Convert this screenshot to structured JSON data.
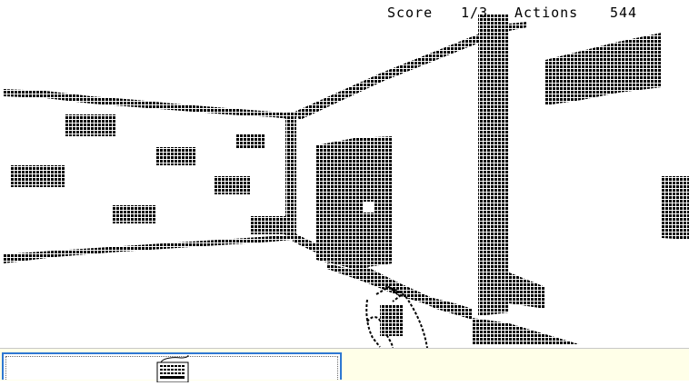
{
  "hud": {
    "score_label": "Score",
    "score_value": "1/3",
    "actions_label": "Actions",
    "actions_value": "544"
  },
  "inventory": {
    "item_icon": "keyboard-icon"
  },
  "colors": {
    "background": "#ffffff",
    "pixel": "#000000",
    "inventory_border": "#2e78d2",
    "message_bar": "#ffffe8"
  }
}
